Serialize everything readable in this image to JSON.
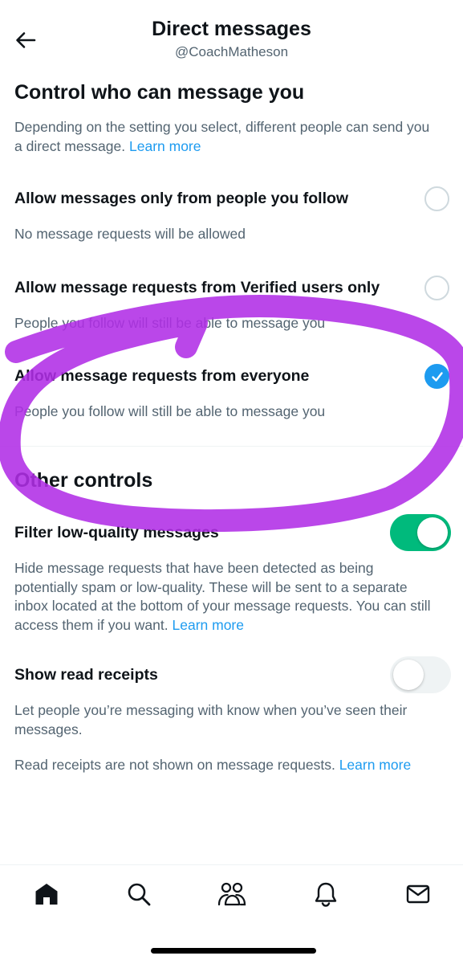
{
  "header": {
    "title": "Direct messages",
    "handle": "@CoachMatheson"
  },
  "control_section": {
    "title": "Control who can message you",
    "description": "Depending on the setting you select, different people can send you a direct message.",
    "learn_more": "Learn more",
    "options": [
      {
        "title": "Allow messages only from people you follow",
        "subtitle": "No message requests will be allowed",
        "selected": false
      },
      {
        "title": "Allow message requests from Verified users only",
        "subtitle": "People you follow will still be able to message you",
        "selected": false
      },
      {
        "title": "Allow message requests from everyone",
        "subtitle": "People you follow will still be able to message you",
        "selected": true
      }
    ]
  },
  "other_controls": {
    "title": "Other controls",
    "filter": {
      "label": "Filter low-quality messages",
      "description": "Hide message requests that have been detected as being potentially spam or low-quality. These will be sent to a separate inbox located at the bottom of your message requests. You can still access them if you want.",
      "learn_more": "Learn more",
      "enabled": true
    },
    "read_receipts": {
      "label": "Show read receipts",
      "description": "Let people you’re messaging with know when you’ve seen their messages.",
      "note": "Read receipts are not shown on message requests.",
      "learn_more": "Learn more",
      "enabled": false
    }
  },
  "tabbar": {
    "items": [
      "home-icon",
      "search-icon",
      "communities-icon",
      "notifications-icon",
      "messages-icon"
    ]
  },
  "colors": {
    "accent": "#1d9bf0",
    "toggle_on": "#00ba7c",
    "annotation": "#b02ee6",
    "secondary_text": "#536471"
  }
}
